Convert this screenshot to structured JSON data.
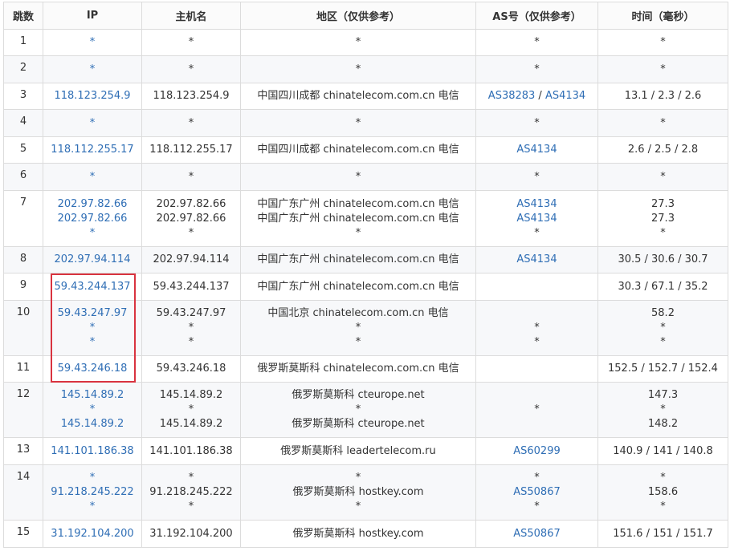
{
  "headers": [
    "跳数",
    "IP",
    "主机名",
    "地区（仅供参考）",
    "AS号（仅供参考）",
    "时间（毫秒）"
  ],
  "rows": [
    {
      "hop": "1",
      "ip": [
        "*"
      ],
      "host": [
        "*"
      ],
      "region": [
        "*"
      ],
      "as": [
        [
          "*"
        ]
      ],
      "time": [
        "*"
      ]
    },
    {
      "hop": "2",
      "ip": [
        "*"
      ],
      "host": [
        "*"
      ],
      "region": [
        "*"
      ],
      "as": [
        [
          "*"
        ]
      ],
      "time": [
        "*"
      ]
    },
    {
      "hop": "3",
      "ip": [
        "118.123.254.9"
      ],
      "host": [
        "118.123.254.9"
      ],
      "region": [
        "中国四川成都 chinatelecom.com.cn 电信"
      ],
      "as": [
        [
          "AS38283",
          "AS4134"
        ]
      ],
      "time": [
        "13.1 / 2.3 / 2.6"
      ]
    },
    {
      "hop": "4",
      "ip": [
        "*"
      ],
      "host": [
        "*"
      ],
      "region": [
        "*"
      ],
      "as": [
        [
          "*"
        ]
      ],
      "time": [
        "*"
      ]
    },
    {
      "hop": "5",
      "ip": [
        "118.112.255.17"
      ],
      "host": [
        "118.112.255.17"
      ],
      "region": [
        "中国四川成都 chinatelecom.com.cn 电信"
      ],
      "as": [
        [
          "AS4134"
        ]
      ],
      "time": [
        "2.6 / 2.5 / 2.8"
      ]
    },
    {
      "hop": "6",
      "ip": [
        "*"
      ],
      "host": [
        "*"
      ],
      "region": [
        "*"
      ],
      "as": [
        [
          "*"
        ]
      ],
      "time": [
        "*"
      ]
    },
    {
      "hop": "7",
      "ip": [
        "202.97.82.66",
        "202.97.82.66",
        "*"
      ],
      "host": [
        "202.97.82.66",
        "202.97.82.66",
        "*"
      ],
      "region": [
        "中国广东广州 chinatelecom.com.cn 电信",
        "中国广东广州 chinatelecom.com.cn 电信",
        "*"
      ],
      "as": [
        [
          "AS4134"
        ],
        [
          "AS4134"
        ],
        [
          "*"
        ]
      ],
      "time": [
        "27.3",
        "27.3",
        "*"
      ]
    },
    {
      "hop": "8",
      "ip": [
        "202.97.94.114"
      ],
      "host": [
        "202.97.94.114"
      ],
      "region": [
        "中国广东广州 chinatelecom.com.cn 电信"
      ],
      "as": [
        [
          "AS4134"
        ]
      ],
      "time": [
        "30.5 / 30.6 / 30.7"
      ]
    },
    {
      "hop": "9",
      "ip": [
        "59.43.244.137"
      ],
      "host": [
        "59.43.244.137"
      ],
      "region": [
        "中国广东广州 chinatelecom.com.cn 电信"
      ],
      "as": [
        [
          ""
        ]
      ],
      "time": [
        "30.3 / 67.1 / 35.2"
      ]
    },
    {
      "hop": "10",
      "ip": [
        "59.43.247.97",
        "*",
        "*"
      ],
      "host": [
        "59.43.247.97",
        "*",
        "*"
      ],
      "region": [
        "中国北京 chinatelecom.com.cn 电信",
        "*",
        "*"
      ],
      "as": [
        [
          ""
        ],
        [
          "*"
        ],
        [
          "*"
        ]
      ],
      "time": [
        "58.2",
        "*",
        "*"
      ]
    },
    {
      "hop": "11",
      "ip": [
        "59.43.246.18"
      ],
      "host": [
        "59.43.246.18"
      ],
      "region": [
        "俄罗斯莫斯科 chinatelecom.com.cn 电信"
      ],
      "as": [
        [
          ""
        ]
      ],
      "time": [
        "152.5 / 152.7 / 152.4"
      ]
    },
    {
      "hop": "12",
      "ip": [
        "145.14.89.2",
        "*",
        "145.14.89.2"
      ],
      "host": [
        "145.14.89.2",
        "*",
        "145.14.89.2"
      ],
      "region": [
        "俄罗斯莫斯科 cteurope.net",
        "*",
        "俄罗斯莫斯科 cteurope.net"
      ],
      "as": [
        [
          ""
        ],
        [
          "*"
        ],
        [
          ""
        ]
      ],
      "time": [
        "147.3",
        "*",
        "148.2"
      ]
    },
    {
      "hop": "13",
      "ip": [
        "141.101.186.38"
      ],
      "host": [
        "141.101.186.38"
      ],
      "region": [
        "俄罗斯莫斯科 leadertelecom.ru"
      ],
      "as": [
        [
          "AS60299"
        ]
      ],
      "time": [
        "140.9 / 141 / 140.8"
      ]
    },
    {
      "hop": "14",
      "ip": [
        "*",
        "91.218.245.222",
        "*"
      ],
      "host": [
        "*",
        "91.218.245.222",
        "*"
      ],
      "region": [
        "*",
        "俄罗斯莫斯科 hostkey.com",
        "*"
      ],
      "as": [
        [
          "*"
        ],
        [
          "AS50867"
        ],
        [
          "*"
        ]
      ],
      "time": [
        "*",
        "158.6",
        "*"
      ]
    },
    {
      "hop": "15",
      "ip": [
        "31.192.104.200"
      ],
      "host": [
        "31.192.104.200"
      ],
      "region": [
        "俄罗斯莫斯科 hostkey.com"
      ],
      "as": [
        [
          "AS50867"
        ]
      ],
      "time": [
        "151.6 / 151 / 151.7"
      ]
    }
  ],
  "colors": {
    "link": "#2f6eb5",
    "highlight": "#d9333f",
    "stripe": "#f7f8fa",
    "border": "#dcdcdc"
  }
}
